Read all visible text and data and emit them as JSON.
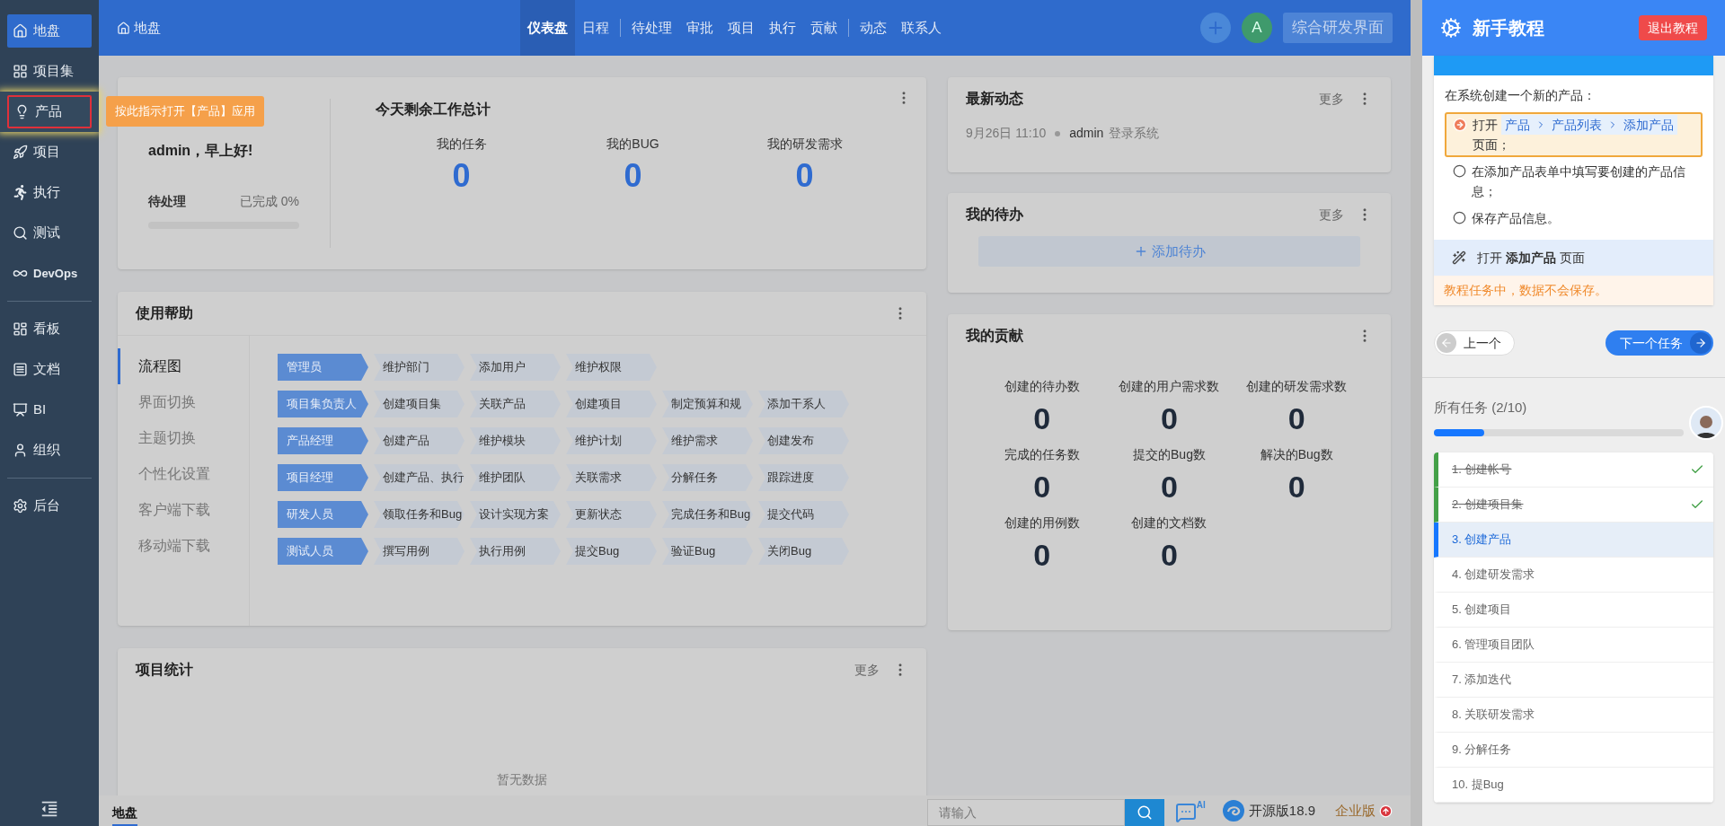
{
  "sidebar": {
    "items": [
      {
        "label": "地盘",
        "selected": true,
        "highlighted": false
      },
      {
        "label": "项目集",
        "selected": false,
        "highlighted": false
      },
      {
        "label": "产品",
        "selected": false,
        "highlighted": true
      },
      {
        "label": "项目",
        "selected": false,
        "highlighted": false
      },
      {
        "label": "执行",
        "selected": false,
        "highlighted": false
      },
      {
        "label": "测试",
        "selected": false,
        "highlighted": false
      },
      {
        "label": "DevOps",
        "selected": false,
        "highlighted": false,
        "divider_after": true
      },
      {
        "label": "看板",
        "selected": false,
        "highlighted": false
      },
      {
        "label": "文档",
        "selected": false,
        "highlighted": false
      },
      {
        "label": "BI",
        "selected": false,
        "highlighted": false
      },
      {
        "label": "组织",
        "selected": false,
        "highlighted": false,
        "divider_after": true
      },
      {
        "label": "后台",
        "selected": false,
        "highlighted": false
      }
    ],
    "tooltip": "按此指示打开【产品】应用"
  },
  "topbar": {
    "home": "地盘",
    "tabs": [
      {
        "label": "仪表盘",
        "selected": true
      },
      {
        "label": "日程",
        "selected": false,
        "divider_after": true
      },
      {
        "label": "待处理",
        "selected": false
      },
      {
        "label": "审批",
        "selected": false
      },
      {
        "label": "项目",
        "selected": false
      },
      {
        "label": "执行",
        "selected": false
      },
      {
        "label": "贡献",
        "selected": false,
        "divider_after": true
      },
      {
        "label": "动态",
        "selected": false
      },
      {
        "label": "联系人",
        "selected": false
      }
    ],
    "avatar": "A",
    "view_button": "综合研发界面"
  },
  "welcome": {
    "greeting": "admin，早上好!",
    "pending": "待处理",
    "done": "已完成 0%",
    "level": 0,
    "summary_title": "今天剩余工作总计",
    "stats": [
      {
        "label": "我的任务",
        "value": "0"
      },
      {
        "label": "我的BUG",
        "value": "0"
      },
      {
        "label": "我的研发需求",
        "value": "0"
      }
    ]
  },
  "help": {
    "title": "使用帮助",
    "tabs": [
      {
        "label": "流程图",
        "selected": true
      },
      {
        "label": "界面切换",
        "selected": false
      },
      {
        "label": "主题切换",
        "selected": false
      },
      {
        "label": "个性化设置",
        "selected": false
      },
      {
        "label": "客户端下载",
        "selected": false
      },
      {
        "label": "移动端下载",
        "selected": false
      }
    ],
    "flows": [
      {
        "role": "管理员",
        "steps": [
          "维护部门",
          "添加用户",
          "维护权限"
        ]
      },
      {
        "role": "项目集负责人",
        "steps": [
          "创建项目集",
          "关联产品",
          "创建项目",
          "制定预算和规",
          "添加干系人"
        ]
      },
      {
        "role": "产品经理",
        "steps": [
          "创建产品",
          "维护模块",
          "维护计划",
          "维护需求",
          "创建发布"
        ]
      },
      {
        "role": "项目经理",
        "steps": [
          "创建产品、执行",
          "维护团队",
          "关联需求",
          "分解任务",
          "跟踪进度"
        ]
      },
      {
        "role": "研发人员",
        "steps": [
          "领取任务和Bug",
          "设计实现方案",
          "更新状态",
          "完成任务和Bug",
          "提交代码"
        ]
      },
      {
        "role": "测试人员",
        "steps": [
          "撰写用例",
          "执行用例",
          "提交Bug",
          "验证Bug",
          "关闭Bug"
        ]
      }
    ]
  },
  "project_stats": {
    "title": "项目统计",
    "more": "更多",
    "empty": "暂无数据"
  },
  "activity": {
    "title": "最新动态",
    "more": "更多",
    "entries": [
      {
        "time": "9月26日 11:10",
        "user": "admin",
        "action": "登录系统"
      }
    ]
  },
  "todo": {
    "title": "我的待办",
    "more": "更多",
    "add": "添加待办"
  },
  "contribution": {
    "title": "我的贡献",
    "stats": [
      {
        "label": "创建的待办数",
        "value": "0"
      },
      {
        "label": "创建的用户需求数",
        "value": "0"
      },
      {
        "label": "创建的研发需求数",
        "value": "0"
      },
      {
        "label": "完成的任务数",
        "value": "0"
      },
      {
        "label": "提交的Bug数",
        "value": "0"
      },
      {
        "label": "解决的Bug数",
        "value": "0"
      },
      {
        "label": "创建的用例数",
        "value": "0"
      },
      {
        "label": "创建的文档数",
        "value": "0"
      }
    ]
  },
  "footer": {
    "tab": "地盘",
    "search_placeholder": "请输入",
    "ai_label": "AI",
    "version": "开源版18.9",
    "enterprise": "企业版"
  },
  "tutorial": {
    "title": "新手教程",
    "exit": "退出教程",
    "intro": "在系统创建一个新的产品：",
    "steps": [
      {
        "kind": "path",
        "current": true,
        "prefix": "打开",
        "path": [
          "产品",
          "产品列表",
          "添加产品"
        ],
        "suffix": "页面；"
      },
      {
        "kind": "text",
        "current": false,
        "text": "在添加产品表单中填写要创建的产品信息；"
      },
      {
        "kind": "text",
        "current": false,
        "text": "保存产品信息。"
      }
    ],
    "hint": "打开 **添加产品** 页面",
    "warning": "教程任务中，数据不会保存。",
    "prev": "上一个",
    "next": "下一个任务",
    "progress_label": "所有任务 (2/10)",
    "level": 0.2,
    "tasks": [
      {
        "label": "1. 创建帐号",
        "done": true,
        "selected": false
      },
      {
        "label": "2. 创建项目集",
        "done": true,
        "selected": false
      },
      {
        "label": "3. 创建产品",
        "done": false,
        "selected": true
      },
      {
        "label": "4. 创建研发需求",
        "done": false,
        "selected": false
      },
      {
        "label": "5. 创建项目",
        "done": false,
        "selected": false
      },
      {
        "label": "6. 管理项目团队",
        "done": false,
        "selected": false
      },
      {
        "label": "7. 添加迭代",
        "done": false,
        "selected": false
      },
      {
        "label": "8. 关联研发需求",
        "done": false,
        "selected": false
      },
      {
        "label": "9. 分解任务",
        "done": false,
        "selected": false
      },
      {
        "label": "10. 提Bug",
        "done": false,
        "selected": false
      }
    ]
  }
}
